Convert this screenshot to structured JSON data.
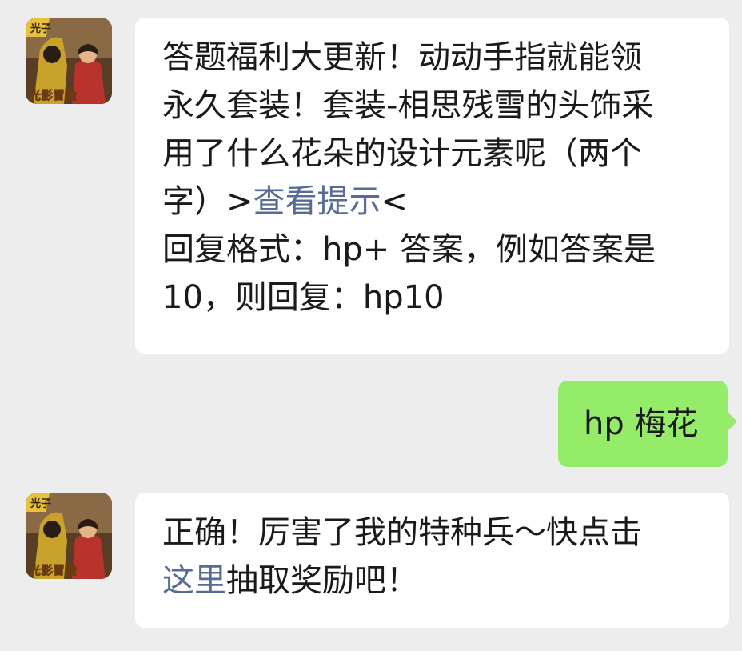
{
  "chat": {
    "messages": [
      {
        "sender": "official-account",
        "avatar_badge_top": "光子",
        "avatar_badge_bottom": "光影冒险",
        "lines": [
          "答题福利大更新！动动手指就能领",
          "永久套装！套装-相思残雪的头饰采",
          "用了什么花朵的设计元素呢（两个"
        ],
        "line4_pre": "字）>",
        "hint_link": "查看提示",
        "line4_post": "<",
        "line5": "回复格式：hp+ 答案，例如答案是",
        "line6": "10，则回复：hp10"
      },
      {
        "sender": "me",
        "text": "hp 梅花"
      },
      {
        "sender": "official-account",
        "avatar_badge_top": "光子",
        "avatar_badge_bottom": "光影冒险",
        "line1": "正确！厉害了我的特种兵～快点击",
        "here_link": "这里",
        "line2_post": "抽取奖励吧！"
      }
    ]
  },
  "colors": {
    "background": "#ededed",
    "incoming_bubble": "#ffffff",
    "outgoing_bubble": "#95ec69",
    "link": "#576b95"
  }
}
